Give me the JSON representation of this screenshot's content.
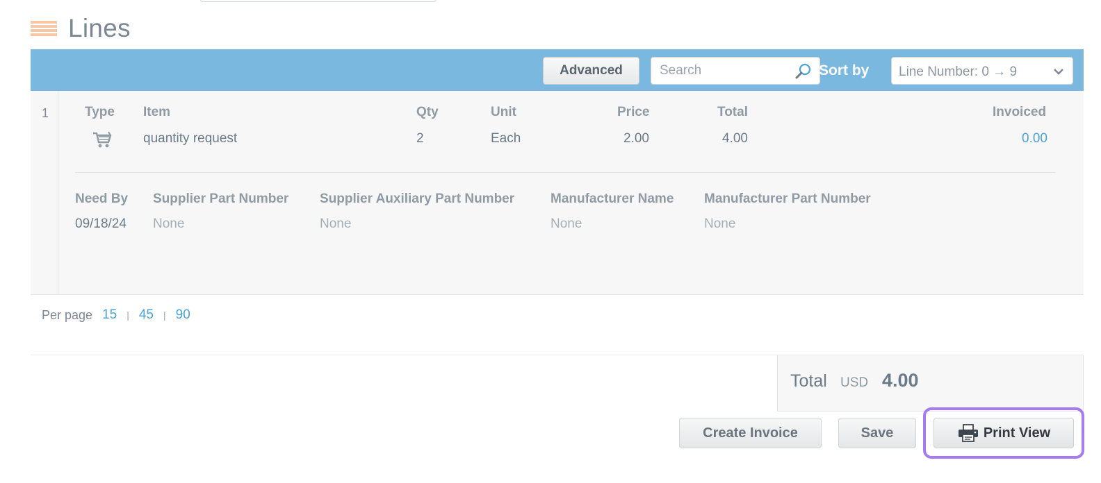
{
  "section": {
    "title": "Lines"
  },
  "toolbar": {
    "advanced_label": "Advanced",
    "search_placeholder": "Search",
    "sort_label": "Sort by",
    "sort_value": "Line Number: 0 → 9"
  },
  "line": {
    "number": "1",
    "headers": {
      "type": "Type",
      "item": "Item",
      "qty": "Qty",
      "unit": "Unit",
      "price": "Price",
      "total": "Total",
      "invoiced": "Invoiced"
    },
    "values": {
      "type_icon": "shopping-cart-icon",
      "item": "quantity request",
      "qty": "2",
      "unit": "Each",
      "price": "2.00",
      "total": "4.00",
      "invoiced": "0.00"
    },
    "details_headers": {
      "need_by": "Need By",
      "supplier_part_number": "Supplier Part Number",
      "supplier_aux_part_number": "Supplier Auxiliary Part Number",
      "manufacturer_name": "Manufacturer Name",
      "manufacturer_part_number": "Manufacturer Part Number"
    },
    "details_values": {
      "need_by": "09/18/24",
      "supplier_part_number": "None",
      "supplier_aux_part_number": "None",
      "manufacturer_name": "None",
      "manufacturer_part_number": "None"
    }
  },
  "pagination": {
    "label": "Per page",
    "options": [
      "15",
      "45",
      "90"
    ]
  },
  "totals": {
    "label": "Total",
    "currency": "USD",
    "amount": "4.00"
  },
  "actions": {
    "create_invoice": "Create Invoice",
    "save": "Save",
    "print_view": "Print View"
  },
  "colors": {
    "toolbar_bg": "#7ab8e0",
    "link": "#4aa3d8",
    "highlight": "#a47cf0"
  }
}
